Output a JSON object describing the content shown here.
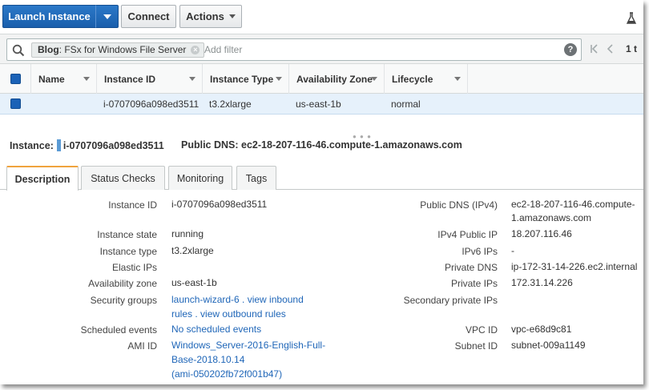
{
  "toolbar": {
    "launch_label": "Launch Instance",
    "connect_label": "Connect",
    "actions_label": "Actions"
  },
  "filter": {
    "chip_key": "Blog",
    "chip_value": ": FSx for Windows File Server",
    "placeholder": "Add filter",
    "help": "?",
    "page_count": "1 t"
  },
  "table": {
    "columns": [
      "Name",
      "Instance ID",
      "Instance Type",
      "Availability Zone",
      "Lifecycle"
    ],
    "row": {
      "name": "",
      "instance_id": "i-0707096a098ed3511",
      "instance_type": "t3.2xlarge",
      "availability_zone": "us-east-1b",
      "lifecycle": "normal"
    }
  },
  "detail": {
    "instance_label": "Instance:",
    "instance_id": "i-0707096a098ed3511",
    "public_dns_label": "Public DNS:",
    "public_dns": "ec2-18-207-116-46.compute-1.amazonaws.com"
  },
  "tabs": [
    "Description",
    "Status Checks",
    "Monitoring",
    "Tags"
  ],
  "description": {
    "left": {
      "instance_id": {
        "label": "Instance ID",
        "value": "i-0707096a098ed3511"
      },
      "instance_state": {
        "label": "Instance state",
        "value": "running"
      },
      "instance_type": {
        "label": "Instance type",
        "value": "t3.2xlarge"
      },
      "elastic_ips": {
        "label": "Elastic IPs",
        "value": ""
      },
      "availability_zone": {
        "label": "Availability zone",
        "value": "us-east-1b"
      },
      "security_groups": {
        "label": "Security groups",
        "group": "launch-wizard-6",
        "view_inbound": "view inbound",
        "rules": "rules",
        "view_outbound": "view outbound rules"
      },
      "scheduled_events": {
        "label": "Scheduled events",
        "value": "No scheduled events"
      },
      "ami_id": {
        "label": "AMI ID",
        "line1": "Windows_Server-2016-English-Full-",
        "line2": "Base-2018.10.14",
        "line3": "(ami-050202fb72f001b47)"
      }
    },
    "right": {
      "public_dns": {
        "label": "Public DNS (IPv4)",
        "line1": "ec2-18-207-116-46.compute-",
        "line2": "1.amazonaws.com"
      },
      "ipv4_public_ip": {
        "label": "IPv4 Public IP",
        "value": "18.207.116.46"
      },
      "ipv6_ips": {
        "label": "IPv6 IPs",
        "value": "-"
      },
      "private_dns": {
        "label": "Private DNS",
        "value": "ip-172-31-14-226.ec2.internal"
      },
      "private_ips": {
        "label": "Private IPs",
        "value": "172.31.14.226"
      },
      "secondary_private_ips": {
        "label": "Secondary private IPs",
        "value": ""
      },
      "vpc_id": {
        "label": "VPC ID",
        "value": "vpc-e68d9c81"
      },
      "subnet_id": {
        "label": "Subnet ID",
        "value": "subnet-009a1149"
      }
    }
  },
  "colors": {
    "primary_button": "#1f6bbd",
    "link": "#1f66b8",
    "selected_row": "#e6f1fb",
    "active_tab_accent": "#f0a33e"
  }
}
